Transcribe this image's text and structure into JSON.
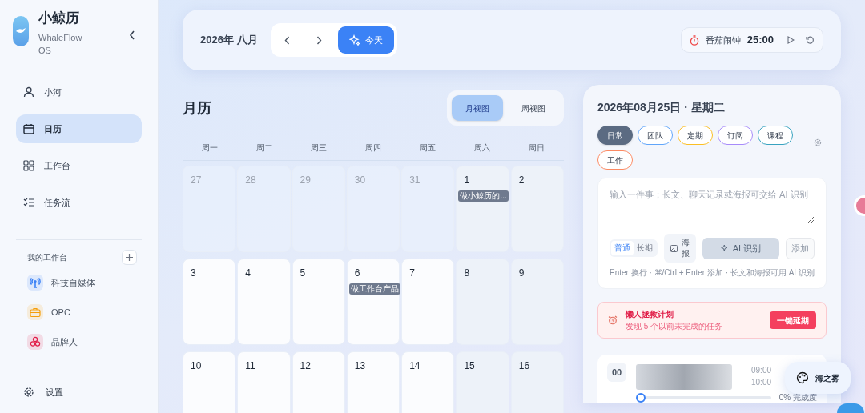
{
  "sidebar": {
    "app_name": "小鲸历",
    "app_subtitle": "WhaleFlow OS",
    "nav": [
      {
        "label": "小河",
        "selected": false
      },
      {
        "label": "日历",
        "selected": true
      },
      {
        "label": "工作台",
        "selected": false
      },
      {
        "label": "任务流",
        "selected": false
      }
    ],
    "workspace_heading": "我的工作台",
    "workspaces": [
      {
        "label": "科技自媒体",
        "color": "#3b82f6"
      },
      {
        "label": "OPC",
        "color": "#f59e0b"
      },
      {
        "label": "品牌人",
        "color": "#e11d48"
      }
    ],
    "settings": "设置"
  },
  "header": {
    "month": "2026年 八月",
    "today": "今天",
    "timer_label": "番茄闹钟",
    "timer": "25:00"
  },
  "calendar": {
    "title": "月历",
    "views": [
      {
        "label": "月视图",
        "selected": true
      },
      {
        "label": "周视图",
        "selected": false
      }
    ],
    "weekdays": [
      "周一",
      "周二",
      "周三",
      "周四",
      "周五",
      "周六",
      "周日"
    ],
    "weeks": [
      [
        {
          "day": "27",
          "muted": true
        },
        {
          "day": "28",
          "muted": true
        },
        {
          "day": "29",
          "muted": true
        },
        {
          "day": "30",
          "muted": true
        },
        {
          "day": "31",
          "muted": true
        },
        {
          "day": "1",
          "muted": false,
          "events": [
            "做小鲸历的..."
          ]
        },
        {
          "day": "2",
          "muted": false
        }
      ],
      [
        {
          "day": "3",
          "muted": false
        },
        {
          "day": "4",
          "muted": false
        },
        {
          "day": "5",
          "muted": false
        },
        {
          "day": "6",
          "muted": false,
          "events": [
            "做工作台产品"
          ]
        },
        {
          "day": "7",
          "muted": false
        },
        {
          "day": "8",
          "muted": false
        },
        {
          "day": "9",
          "muted": false
        }
      ],
      [
        {
          "day": "10",
          "muted": false
        },
        {
          "day": "11",
          "muted": false
        },
        {
          "day": "12",
          "muted": false
        },
        {
          "day": "13",
          "muted": false
        },
        {
          "day": "14",
          "muted": false
        },
        {
          "day": "15",
          "muted": false
        },
        {
          "day": "16",
          "muted": false
        }
      ]
    ]
  },
  "day_panel": {
    "date": "2026年08月25日 · 星期二",
    "tags": [
      {
        "label": "日常",
        "color": "#5b6b82",
        "selected": true
      },
      {
        "label": "团队",
        "color": "#60a5fa",
        "selected": false
      },
      {
        "label": "定期",
        "color": "#fbbf24",
        "selected": false
      },
      {
        "label": "订阅",
        "color": "#a78bfa",
        "selected": false
      },
      {
        "label": "课程",
        "color": "#38a3c0",
        "selected": false
      },
      {
        "label": "工作",
        "color": "#fb8a63",
        "selected": false
      }
    ],
    "input": {
      "placeholder": "输入一件事；长文、聊天记录或海报可交给 AI 识别",
      "modes": [
        {
          "label": "普通",
          "selected": true
        },
        {
          "label": "长期",
          "selected": false
        }
      ],
      "poster": "海报",
      "ai": {
        "label": "AI 识别",
        "disabled": true
      },
      "add": {
        "label": "添加",
        "disabled": true
      },
      "hint": "Enter 换行 · ⌘/Ctrl + Enter 添加 · 长文和海报可用 AI 识别"
    },
    "alert": {
      "title": "懒人拯救计划",
      "text": "发现 5 个以前未完成的任务",
      "action": "一键延期"
    },
    "task": {
      "index": "00",
      "time": "09:00 - 10:00",
      "level": 0,
      "progress": "0% 完成度"
    },
    "theme_chip": "海之雾"
  }
}
